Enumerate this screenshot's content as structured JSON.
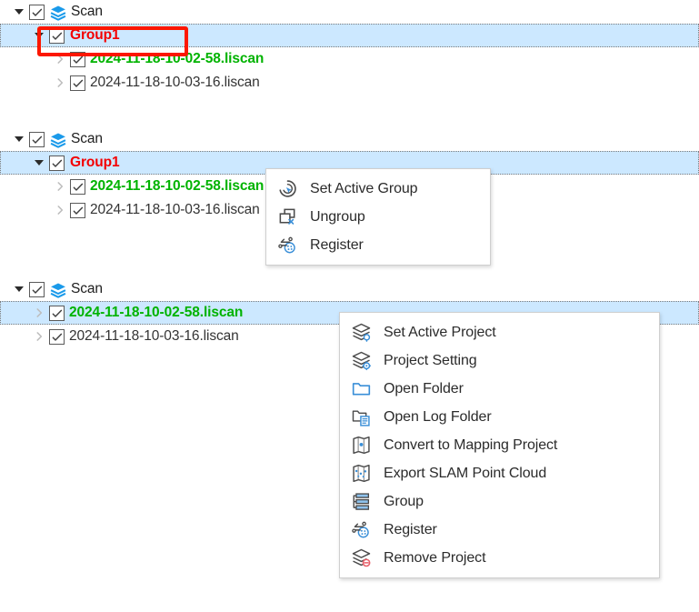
{
  "panels": [
    {
      "id": "panel-top",
      "rows": [
        {
          "indent": 0,
          "expander": "chevron-down-icon",
          "checked": true,
          "icon": "layers-icon",
          "label": "Scan",
          "style": "plain",
          "selected": false
        },
        {
          "indent": 1,
          "expander": "chevron-down-icon",
          "checked": true,
          "icon": null,
          "label": "Group1",
          "style": "group",
          "selected": true
        },
        {
          "indent": 2,
          "expander": "chevron-right-icon",
          "checked": true,
          "icon": null,
          "label": "2024-11-18-10-02-58.liscan",
          "style": "active-scan",
          "selected": false
        },
        {
          "indent": 2,
          "expander": "chevron-right-icon",
          "checked": true,
          "icon": null,
          "label": "2024-11-18-10-03-16.liscan",
          "style": "plain-scan",
          "selected": false
        }
      ]
    },
    {
      "id": "panel-middle",
      "rows": [
        {
          "indent": 0,
          "expander": "chevron-down-icon",
          "checked": true,
          "icon": "layers-icon",
          "label": "Scan",
          "style": "plain",
          "selected": false
        },
        {
          "indent": 1,
          "expander": "chevron-down-icon",
          "checked": true,
          "icon": null,
          "label": "Group1",
          "style": "group",
          "selected": true
        },
        {
          "indent": 2,
          "expander": "chevron-right-icon",
          "checked": true,
          "icon": null,
          "label": "2024-11-18-10-02-58.liscan",
          "style": "active-scan",
          "selected": false
        },
        {
          "indent": 2,
          "expander": "chevron-right-icon",
          "checked": true,
          "icon": null,
          "label": "2024-11-18-10-03-16.liscan",
          "style": "plain-scan",
          "selected": false
        }
      ]
    },
    {
      "id": "panel-bottom",
      "rows": [
        {
          "indent": 0,
          "expander": "chevron-down-icon",
          "checked": true,
          "icon": "layers-icon",
          "label": "Scan",
          "style": "plain",
          "selected": false
        },
        {
          "indent": 1,
          "expander": "chevron-right-icon",
          "checked": true,
          "icon": null,
          "label": "2024-11-18-10-02-58.liscan",
          "style": "active-scan",
          "selected": true
        },
        {
          "indent": 1,
          "expander": "chevron-right-icon",
          "checked": true,
          "icon": null,
          "label": "2024-11-18-10-03-16.liscan",
          "style": "plain-scan",
          "selected": false
        }
      ]
    }
  ],
  "annotation": {
    "shape": "rectangle",
    "color": "#fc1700",
    "target_label": "Group1"
  },
  "group_context_menu": {
    "items": [
      {
        "label": "Set Active Group",
        "icon": "set-active-group-icon"
      },
      {
        "label": "Ungroup",
        "icon": "ungroup-icon"
      },
      {
        "label": "Register",
        "icon": "register-icon"
      }
    ]
  },
  "project_context_menu": {
    "items": [
      {
        "label": "Set Active Project",
        "icon": "set-active-project-icon"
      },
      {
        "label": "Project Setting",
        "icon": "project-setting-icon"
      },
      {
        "label": "Open Folder",
        "icon": "open-folder-icon"
      },
      {
        "label": "Open Log Folder",
        "icon": "open-log-folder-icon"
      },
      {
        "label": "Convert to Mapping Project",
        "icon": "map-convert-icon"
      },
      {
        "label": "Export SLAM Point Cloud",
        "icon": "map-points-icon"
      },
      {
        "label": "Group",
        "icon": "group-icon"
      },
      {
        "label": "Register",
        "icon": "register-icon"
      },
      {
        "label": "Remove Project",
        "icon": "remove-project-icon"
      }
    ]
  },
  "colors": {
    "selection": "#cce8ff",
    "group_text": "#f40000",
    "active_scan_text": "#00b300",
    "annotation": "#fc1700",
    "layers_icon": "#1a9aea",
    "icon_outline": "#4a4a4a",
    "icon_accent": "#3a8fd8"
  }
}
